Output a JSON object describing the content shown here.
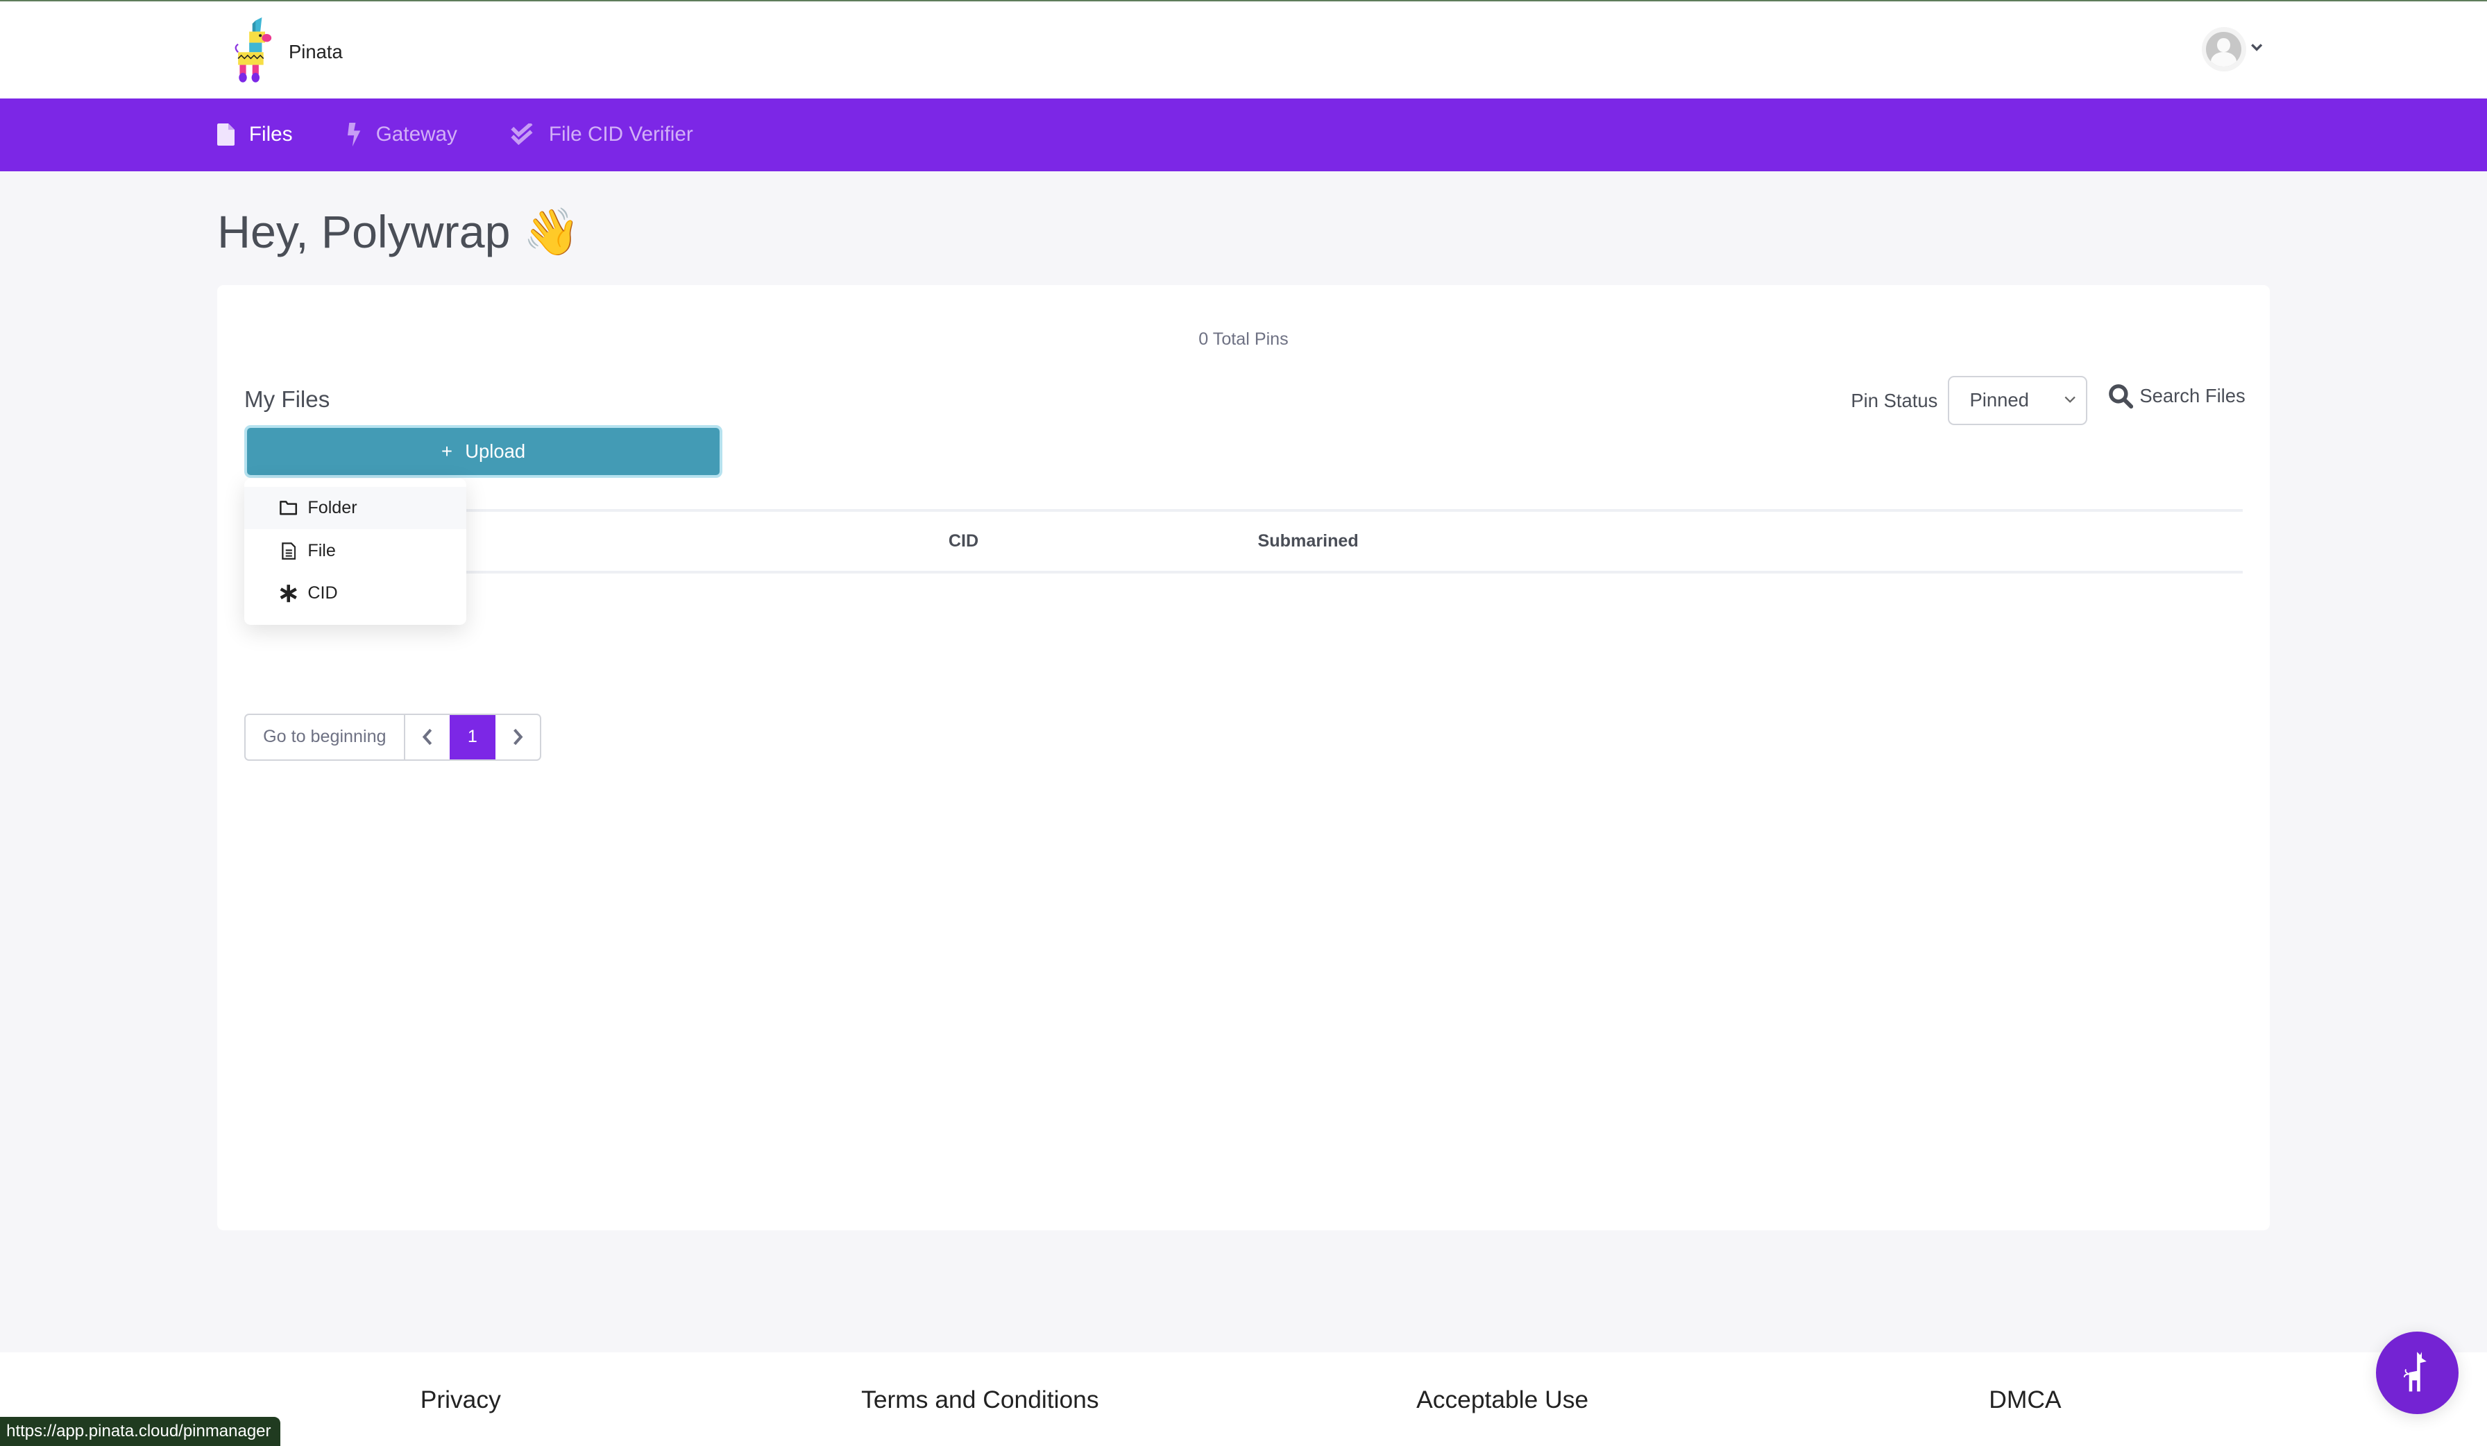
{
  "header": {
    "brand": "Pinata",
    "logo_icon": "pinata-llama-logo",
    "avatar_icon": "user-avatar-icon",
    "avatar_caret": "⌄"
  },
  "nav": {
    "items": [
      {
        "label": "Files",
        "icon": "file-icon",
        "active": true
      },
      {
        "label": "Gateway",
        "icon": "lightning-icon",
        "active": false
      },
      {
        "label": "File CID Verifier",
        "icon": "double-check-icon",
        "active": false
      }
    ]
  },
  "main": {
    "greeting": "Hey, Polywrap 👋",
    "total_pins": "0 Total Pins",
    "my_files_title": "My Files",
    "upload_button": {
      "icon": "+",
      "label": "Upload"
    },
    "pin_status": {
      "label": "Pin Status",
      "selected": "Pinned"
    },
    "search_label": "Search Files",
    "table": {
      "columns": [
        "CID",
        "Submarined"
      ],
      "rows": []
    },
    "upload_menu": [
      {
        "label": "Folder",
        "icon": "folder-icon"
      },
      {
        "label": "File",
        "icon": "document-icon"
      },
      {
        "label": "CID",
        "icon": "asterisk-icon"
      }
    ],
    "pagination": {
      "go_to_beginning": "Go to beginning",
      "prev": "‹",
      "current_page": "1",
      "next": "›"
    }
  },
  "footer": {
    "links": [
      "Privacy",
      "Terms and Conditions",
      "Acceptable Use",
      "DMCA"
    ]
  },
  "status_bar": {
    "url": "https://app.pinata.cloud/pinmanager"
  },
  "colors": {
    "primary_purple": "#7c27e6",
    "upload_teal": "#439bb5",
    "text_dark": "#4a4e57",
    "page_bg": "#f6f6f9"
  }
}
